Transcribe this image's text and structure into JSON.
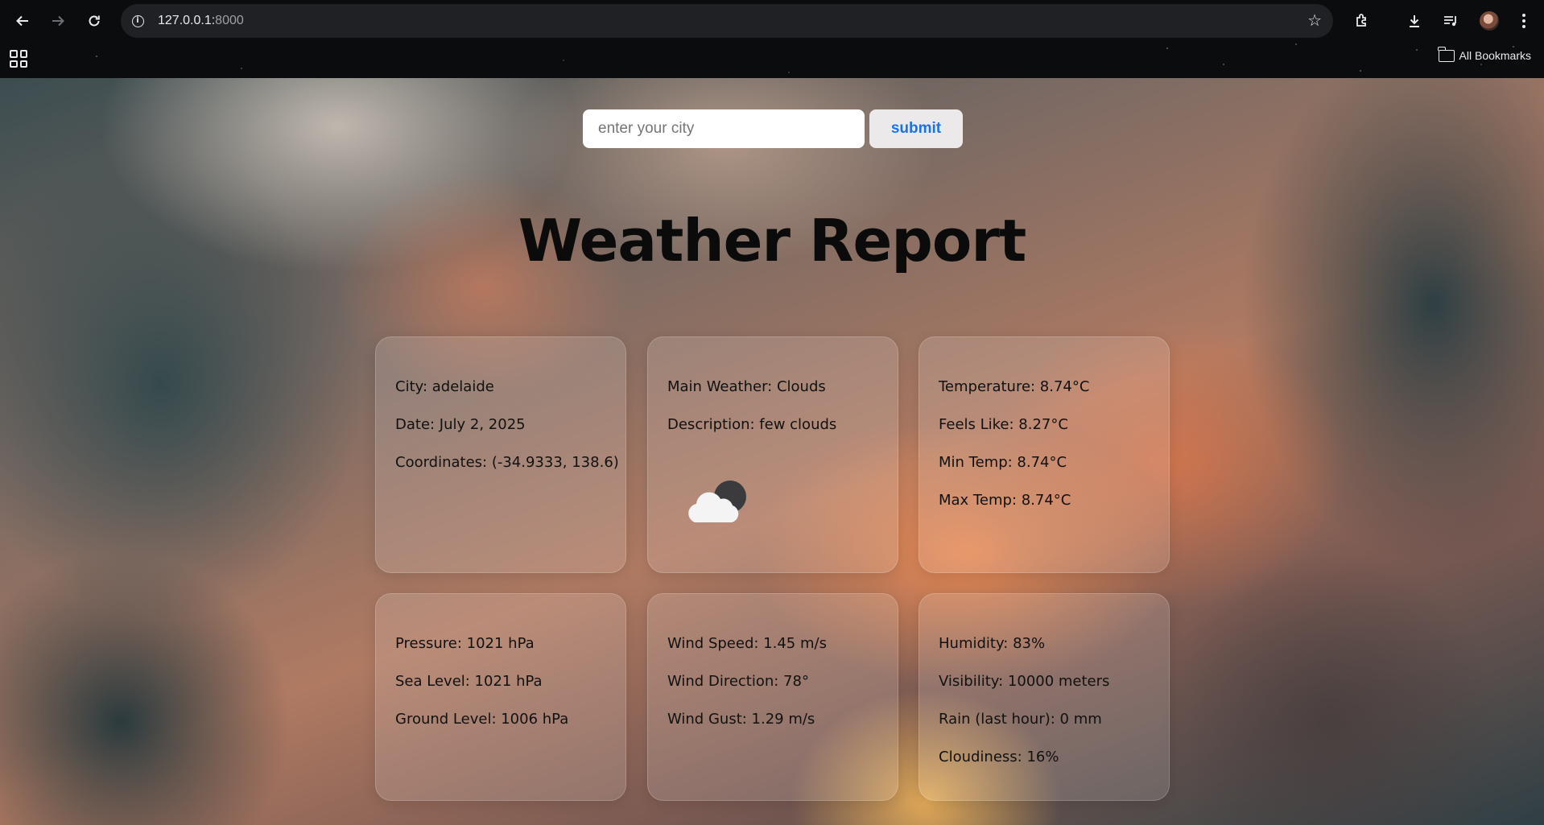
{
  "browser": {
    "url_host": "127.0.0.1:",
    "url_port": "8000",
    "bookmarks_label": "All Bookmarks"
  },
  "search": {
    "placeholder": "enter your city",
    "value": "",
    "submit_label": "submit"
  },
  "title": "Weather Report",
  "cards": {
    "location": {
      "city": "City: adelaide",
      "date": "Date: July 2, 2025",
      "coordinates": "Coordinates: (-34.9333, 138.6)"
    },
    "conditions": {
      "main": "Main Weather: Clouds",
      "description": "Description: few clouds",
      "icon": "few-clouds-night-icon"
    },
    "temperature": {
      "temp": "Temperature: 8.74°C",
      "feels_like": "Feels Like: 8.27°C",
      "min": "Min Temp: 8.74°C",
      "max": "Max Temp: 8.74°C"
    },
    "pressure": {
      "pressure": "Pressure: 1021 hPa",
      "sea_level": "Sea Level: 1021 hPa",
      "ground_level": "Ground Level: 1006 hPa"
    },
    "wind": {
      "speed": "Wind Speed: 1.45 m/s",
      "direction": "Wind Direction: 78°",
      "gust": "Wind Gust: 1.29 m/s"
    },
    "atmosphere": {
      "humidity": "Humidity: 83%",
      "visibility": "Visibility: 10000 meters",
      "rain": "Rain (last hour): 0 mm",
      "cloudiness": "Cloudiness: 16%"
    }
  }
}
